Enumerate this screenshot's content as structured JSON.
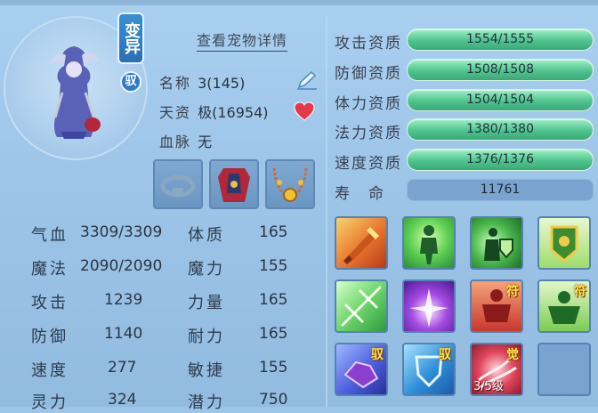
{
  "header": {
    "detail_link": "查看宠物详情"
  },
  "badges": {
    "variant": "变异",
    "yu": "驭"
  },
  "info": {
    "name_label": "名称",
    "name_value": "3(145)",
    "talent_label": "天资",
    "talent_value": "极(16954)",
    "blood_label": "血脉",
    "blood_value": "无"
  },
  "stats_left": [
    {
      "label": "气血",
      "value": "3309/3309"
    },
    {
      "label": "魔法",
      "value": "2090/2090"
    },
    {
      "label": "攻击",
      "value": "1239"
    },
    {
      "label": "防御",
      "value": "1140"
    },
    {
      "label": "速度",
      "value": "277"
    },
    {
      "label": "灵力",
      "value": "324"
    }
  ],
  "stats_right": [
    {
      "label": "体质",
      "value": "165"
    },
    {
      "label": "魔力",
      "value": "155"
    },
    {
      "label": "力量",
      "value": "165"
    },
    {
      "label": "耐力",
      "value": "165"
    },
    {
      "label": "敏捷",
      "value": "155"
    },
    {
      "label": "潜力",
      "value": "750"
    }
  ],
  "aptitudes": [
    {
      "label": "攻击资质",
      "value": "1554/1555",
      "fraction": 0.999
    },
    {
      "label": "防御资质",
      "value": "1508/1508",
      "fraction": 1.0
    },
    {
      "label": "体力资质",
      "value": "1504/1504",
      "fraction": 1.0
    },
    {
      "label": "法力资质",
      "value": "1380/1380",
      "fraction": 1.0
    },
    {
      "label": "速度资质",
      "value": "1376/1376",
      "fraction": 1.0
    }
  ],
  "life": {
    "label": "寿　命",
    "value": "11761"
  },
  "equipment": [
    "collar-slot",
    "armor-slot",
    "necklace-slot"
  ],
  "skills": [
    {
      "icon": "flame-sword-icon",
      "tag": "",
      "level": ""
    },
    {
      "icon": "green-figure-icon",
      "tag": "",
      "level": ""
    },
    {
      "icon": "shield-warrior-icon",
      "tag": "",
      "level": ""
    },
    {
      "icon": "guard-banner-icon",
      "tag": "",
      "level": ""
    },
    {
      "icon": "green-burst-icon",
      "tag": "",
      "level": ""
    },
    {
      "icon": "purple-burst-icon",
      "tag": "",
      "level": ""
    },
    {
      "icon": "red-strongman-icon",
      "tag": "符",
      "level": ""
    },
    {
      "icon": "green-strongman-icon",
      "tag": "符",
      "level": ""
    },
    {
      "icon": "purple-gem-icon",
      "tag": "驭",
      "level": ""
    },
    {
      "icon": "blue-shield-icon",
      "tag": "驭",
      "level": ""
    },
    {
      "icon": "awaken-swirl-icon",
      "tag": "觉",
      "level": "3/5级"
    },
    {
      "icon": "empty-slot-icon",
      "tag": "",
      "level": ""
    }
  ],
  "colors": {
    "bar_green": "#4fc48e",
    "panel_blue": "#9dc5e8",
    "tag_gold": "#ffe14a"
  }
}
